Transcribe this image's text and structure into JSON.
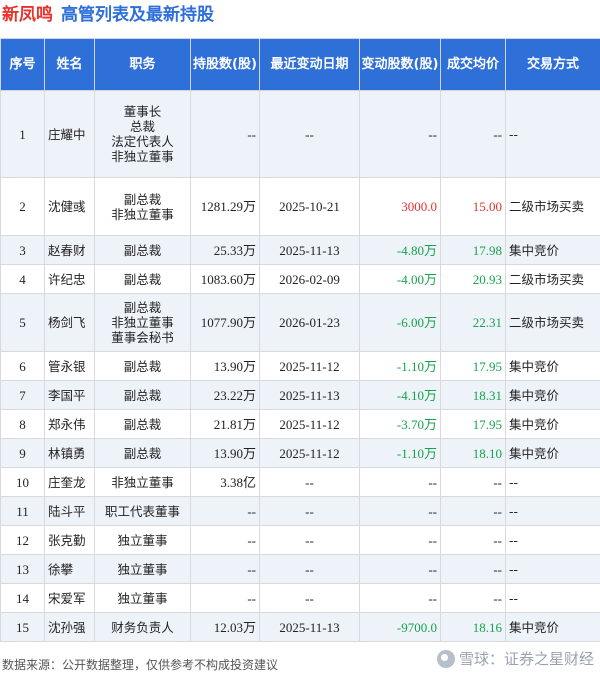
{
  "title": {
    "company": "新凤鸣",
    "text": "高管列表及最新持股"
  },
  "headers": {
    "no": "序号",
    "name": "姓名",
    "duty": "职务",
    "shares": "持股数(股)",
    "date": "最近变动日期",
    "change": "变动股数(股)",
    "price": "成交均价",
    "method": "交易方式"
  },
  "rows": [
    {
      "no": "1",
      "name": "庄耀中",
      "duty": [
        "董事长",
        "总裁",
        "法定代表人",
        "非独立董事"
      ],
      "shares": "--",
      "date": "--",
      "change": "--",
      "change_dir": "none",
      "price": "--",
      "method": "--"
    },
    {
      "no": "2",
      "name": "沈健彧",
      "duty": [
        "副总裁",
        "非独立董事"
      ],
      "shares": "1281.29万",
      "date": "2025-10-21",
      "change": "3000.0",
      "change_dir": "up",
      "price": "15.00",
      "method": "二级市场买卖"
    },
    {
      "no": "3",
      "name": "赵春财",
      "duty": [
        "副总裁"
      ],
      "shares": "25.33万",
      "date": "2025-11-13",
      "change": "-4.80万",
      "change_dir": "down",
      "price": "17.98",
      "method": "集中竞价"
    },
    {
      "no": "4",
      "name": "许纪忠",
      "duty": [
        "副总裁"
      ],
      "shares": "1083.60万",
      "date": "2026-02-09",
      "change": "-4.00万",
      "change_dir": "down",
      "price": "20.93",
      "method": "二级市场买卖"
    },
    {
      "no": "5",
      "name": "杨剑飞",
      "duty": [
        "副总裁",
        "非独立董事",
        "董事会秘书"
      ],
      "shares": "1077.90万",
      "date": "2026-01-23",
      "change": "-6.00万",
      "change_dir": "down",
      "price": "22.31",
      "method": "二级市场买卖"
    },
    {
      "no": "6",
      "name": "管永银",
      "duty": [
        "副总裁"
      ],
      "shares": "13.90万",
      "date": "2025-11-12",
      "change": "-1.10万",
      "change_dir": "down",
      "price": "17.95",
      "method": "集中竞价"
    },
    {
      "no": "7",
      "name": "李国平",
      "duty": [
        "副总裁"
      ],
      "shares": "23.22万",
      "date": "2025-11-13",
      "change": "-4.10万",
      "change_dir": "down",
      "price": "18.31",
      "method": "集中竞价"
    },
    {
      "no": "8",
      "name": "郑永伟",
      "duty": [
        "副总裁"
      ],
      "shares": "21.81万",
      "date": "2025-11-12",
      "change": "-3.70万",
      "change_dir": "down",
      "price": "17.95",
      "method": "集中竞价"
    },
    {
      "no": "9",
      "name": "林镇勇",
      "duty": [
        "副总裁"
      ],
      "shares": "13.90万",
      "date": "2025-11-12",
      "change": "-1.10万",
      "change_dir": "down",
      "price": "18.10",
      "method": "集中竞价"
    },
    {
      "no": "10",
      "name": "庄奎龙",
      "duty": [
        "非独立董事"
      ],
      "shares": "3.38亿",
      "date": "--",
      "change": "--",
      "change_dir": "none",
      "price": "--",
      "method": "--"
    },
    {
      "no": "11",
      "name": "陆斗平",
      "duty": [
        "职工代表董事"
      ],
      "shares": "--",
      "date": "--",
      "change": "--",
      "change_dir": "none",
      "price": "--",
      "method": "--"
    },
    {
      "no": "12",
      "name": "张克勤",
      "duty": [
        "独立董事"
      ],
      "shares": "--",
      "date": "--",
      "change": "--",
      "change_dir": "none",
      "price": "--",
      "method": "--"
    },
    {
      "no": "13",
      "name": "徐攀",
      "duty": [
        "独立董事"
      ],
      "shares": "--",
      "date": "--",
      "change": "--",
      "change_dir": "none",
      "price": "--",
      "method": "--"
    },
    {
      "no": "14",
      "name": "宋爱军",
      "duty": [
        "独立董事"
      ],
      "shares": "--",
      "date": "--",
      "change": "--",
      "change_dir": "none",
      "price": "--",
      "method": "--"
    },
    {
      "no": "15",
      "name": "沈孙强",
      "duty": [
        "财务负责人"
      ],
      "shares": "12.03万",
      "date": "2025-11-13",
      "change": "-9700.0",
      "change_dir": "down",
      "price": "18.16",
      "method": "集中竞价"
    }
  ],
  "footer": {
    "source": "数据来源：公开数据整理，仅供参考不构成投资建议",
    "brand": "雪球：证券之星财经"
  },
  "colors": {
    "header_bg": "#2f6fd8",
    "title_blue": "#2f6fdb",
    "title_red": "#e8322c",
    "up": "#e8322c",
    "down": "#16a34a",
    "row_alt": "#eef3fa"
  }
}
